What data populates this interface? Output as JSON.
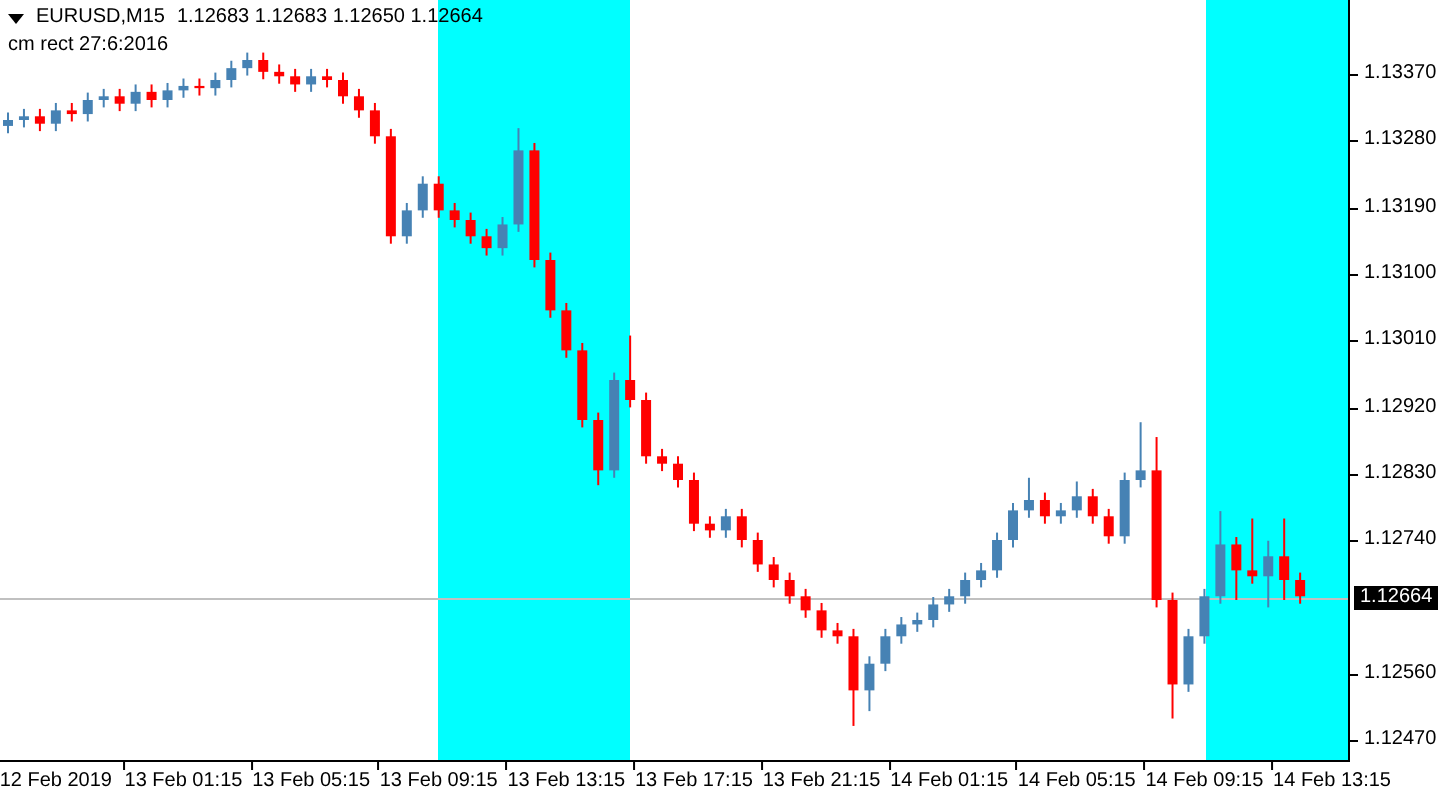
{
  "header": {
    "symbol": "EURUSD,M15",
    "quotes": [
      "1.12683",
      "1.12683",
      "1.12650",
      "1.12664"
    ],
    "indicator": "cm rect 27:6:2016"
  },
  "chart_data": {
    "type": "candlestick",
    "ylim": [
      1.12444,
      1.1347
    ],
    "ref_lines": [
      {
        "axis": "y",
        "value": 1.12664,
        "label": "1.12664",
        "color": "#c0c0c0"
      }
    ],
    "yticks": [
      {
        "value": 1.1337,
        "label": "1.13370"
      },
      {
        "value": 1.1328,
        "label": "1.13280"
      },
      {
        "value": 1.1319,
        "label": "1.13190"
      },
      {
        "value": 1.131,
        "label": "1.13100"
      },
      {
        "value": 1.1301,
        "label": "1.13010"
      },
      {
        "value": 1.1292,
        "label": "1.12920"
      },
      {
        "value": 1.1283,
        "label": "1.12830"
      },
      {
        "value": 1.1274,
        "label": "1.12740"
      },
      {
        "value": 1.1256,
        "label": "1.12560"
      },
      {
        "value": 1.1247,
        "label": "1.12470"
      }
    ],
    "categories": [
      null,
      null,
      null,
      "12 Feb 2019",
      null,
      null,
      null,
      null,
      null,
      null,
      null,
      "13 Feb 01:15",
      null,
      null,
      null,
      null,
      null,
      null,
      null,
      "13 Feb 05:15",
      null,
      null,
      null,
      null,
      null,
      null,
      null,
      "13 Feb 09:15",
      null,
      null,
      null,
      null,
      null,
      null,
      null,
      "13 Feb 13:15",
      null,
      null,
      null,
      null,
      null,
      null,
      null,
      "13 Feb 17:15",
      null,
      null,
      null,
      null,
      null,
      null,
      null,
      "13 Feb 21:15",
      null,
      null,
      null,
      null,
      null,
      null,
      null,
      "14 Feb 01:15",
      null,
      null,
      null,
      null,
      null,
      null,
      null,
      "14 Feb 05:15",
      null,
      null,
      null,
      null,
      null,
      null,
      null,
      "14 Feb 09:15",
      null,
      null,
      null,
      null,
      null,
      null,
      null,
      "14 Feb 13:15"
    ],
    "ohlc": [
      [
        1.133,
        1.13318,
        1.1329,
        1.13308
      ],
      [
        1.13308,
        1.13323,
        1.13298,
        1.13313
      ],
      [
        1.13313,
        1.13323,
        1.13293,
        1.13303
      ],
      [
        1.13303,
        1.13331,
        1.13293,
        1.13321
      ],
      [
        1.13321,
        1.13331,
        1.13306,
        1.13316
      ],
      [
        1.13316,
        1.13345,
        1.13306,
        1.13335
      ],
      [
        1.13335,
        1.1335,
        1.13325,
        1.1334
      ],
      [
        1.1334,
        1.1335,
        1.1332,
        1.1333
      ],
      [
        1.1333,
        1.13356,
        1.1332,
        1.13346
      ],
      [
        1.13346,
        1.13356,
        1.13325,
        1.13335
      ],
      [
        1.13335,
        1.13358,
        1.13325,
        1.13348
      ],
      [
        1.13348,
        1.13364,
        1.13338,
        1.13354
      ],
      [
        1.13354,
        1.13364,
        1.13341,
        1.13351
      ],
      [
        1.13351,
        1.13372,
        1.13341,
        1.13362
      ],
      [
        1.13362,
        1.13388,
        1.13352,
        1.13378
      ],
      [
        1.13378,
        1.13399,
        1.13368,
        1.13389
      ],
      [
        1.13389,
        1.13399,
        1.13363,
        1.13373
      ],
      [
        1.13373,
        1.13383,
        1.13357,
        1.13367
      ],
      [
        1.13367,
        1.13377,
        1.13346,
        1.13356
      ],
      [
        1.13356,
        1.13377,
        1.13346,
        1.13367
      ],
      [
        1.13367,
        1.13377,
        1.13352,
        1.13362
      ],
      [
        1.13362,
        1.13372,
        1.1333,
        1.1334
      ],
      [
        1.1334,
        1.1335,
        1.13311,
        1.13321
      ],
      [
        1.13321,
        1.13331,
        1.13276,
        1.13286
      ],
      [
        1.13286,
        1.13296,
        1.13141,
        1.13151
      ],
      [
        1.13151,
        1.13196,
        1.13141,
        1.13186
      ],
      [
        1.13186,
        1.13232,
        1.13176,
        1.13222
      ],
      [
        1.13222,
        1.13232,
        1.13176,
        1.13186
      ],
      [
        1.13186,
        1.13196,
        1.13163,
        1.13173
      ],
      [
        1.13173,
        1.13183,
        1.13141,
        1.13151
      ],
      [
        1.13151,
        1.13161,
        1.13125,
        1.13135
      ],
      [
        1.13135,
        1.13177,
        1.13125,
        1.13167
      ],
      [
        1.13167,
        1.13297,
        1.13157,
        1.13267
      ],
      [
        1.13267,
        1.13277,
        1.13109,
        1.13119
      ],
      [
        1.13119,
        1.13129,
        1.13041,
        1.13051
      ],
      [
        1.13051,
        1.13061,
        1.12987,
        1.12997
      ],
      [
        1.12997,
        1.13007,
        1.12893,
        1.12903
      ],
      [
        1.12903,
        1.12913,
        1.12815,
        1.12835
      ],
      [
        1.12835,
        1.12967,
        1.12825,
        1.12957
      ],
      [
        1.12957,
        1.13017,
        1.1292,
        1.1293
      ],
      [
        1.1293,
        1.1294,
        1.12844,
        1.12854
      ],
      [
        1.12854,
        1.12864,
        1.12834,
        1.12844
      ],
      [
        1.12844,
        1.12854,
        1.12812,
        1.12822
      ],
      [
        1.12822,
        1.12832,
        1.12753,
        1.12763
      ],
      [
        1.12763,
        1.12773,
        1.12744,
        1.12754
      ],
      [
        1.12754,
        1.12783,
        1.12744,
        1.12773
      ],
      [
        1.12773,
        1.12783,
        1.12731,
        1.12741
      ],
      [
        1.12741,
        1.12751,
        1.12698,
        1.12708
      ],
      [
        1.12708,
        1.12718,
        1.12677,
        1.12687
      ],
      [
        1.12687,
        1.12697,
        1.12655,
        1.12665
      ],
      [
        1.12665,
        1.12675,
        1.12636,
        1.12646
      ],
      [
        1.12646,
        1.12656,
        1.12609,
        1.12619
      ],
      [
        1.12619,
        1.12629,
        1.12601,
        1.12611
      ],
      [
        1.12611,
        1.12621,
        1.1249,
        1.12538
      ],
      [
        1.12538,
        1.12584,
        1.1251,
        1.12574
      ],
      [
        1.12574,
        1.12621,
        1.12564,
        1.12611
      ],
      [
        1.12611,
        1.12637,
        1.12601,
        1.12627
      ],
      [
        1.12627,
        1.12643,
        1.12617,
        1.12633
      ],
      [
        1.12633,
        1.12664,
        1.12623,
        1.12654
      ],
      [
        1.12654,
        1.12675,
        1.12644,
        1.12665
      ],
      [
        1.12665,
        1.12697,
        1.12655,
        1.12687
      ],
      [
        1.12687,
        1.1271,
        1.12677,
        1.127
      ],
      [
        1.127,
        1.12751,
        1.1269,
        1.12741
      ],
      [
        1.12741,
        1.12791,
        1.12731,
        1.12781
      ],
      [
        1.12781,
        1.12825,
        1.12771,
        1.12795
      ],
      [
        1.12795,
        1.12805,
        1.12763,
        1.12773
      ],
      [
        1.12773,
        1.12791,
        1.12763,
        1.12781
      ],
      [
        1.12781,
        1.1282,
        1.12771,
        1.128
      ],
      [
        1.128,
        1.1281,
        1.12763,
        1.12773
      ],
      [
        1.12773,
        1.12783,
        1.12736,
        1.12746
      ],
      [
        1.12746,
        1.12832,
        1.12736,
        1.12822
      ],
      [
        1.12822,
        1.129,
        1.12812,
        1.12835
      ],
      [
        1.12835,
        1.1288,
        1.1265,
        1.1266
      ],
      [
        1.1266,
        1.1267,
        1.125,
        1.12546
      ],
      [
        1.12546,
        1.12621,
        1.12536,
        1.12611
      ],
      [
        1.12611,
        1.12675,
        1.12601,
        1.12665
      ],
      [
        1.12665,
        1.1278,
        1.12655,
        1.12735
      ],
      [
        1.12735,
        1.12745,
        1.1266,
        1.127
      ],
      [
        1.127,
        1.1277,
        1.12682,
        1.12692
      ],
      [
        1.12692,
        1.1274,
        1.1265,
        1.12719
      ],
      [
        1.12719,
        1.1277,
        1.1266,
        1.12687
      ],
      [
        1.12687,
        1.12697,
        1.12655,
        1.12665
      ],
      null,
      null
    ]
  }
}
